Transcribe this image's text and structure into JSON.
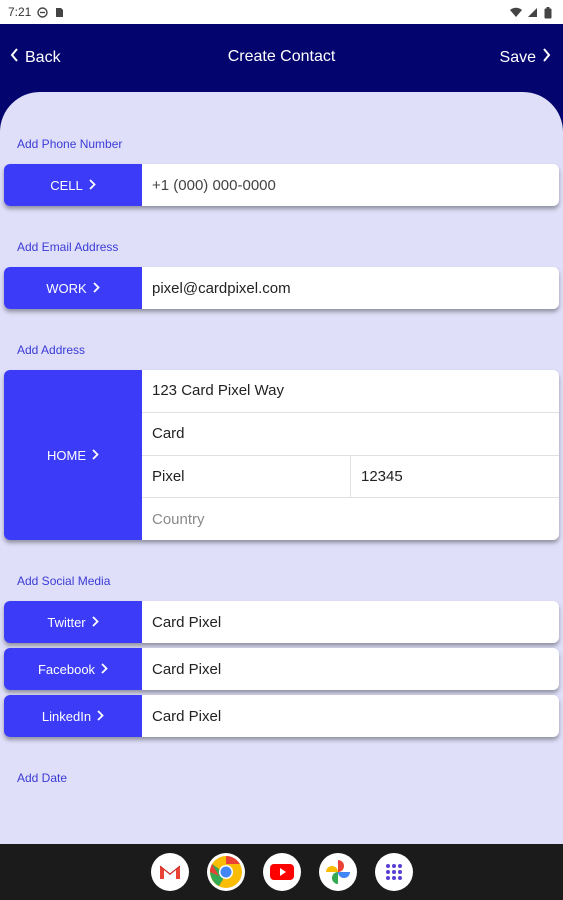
{
  "status_bar": {
    "time": "7:21"
  },
  "nav": {
    "back_label": "Back",
    "title": "Create Contact",
    "save_label": "Save"
  },
  "phone": {
    "section_label": "Add Phone Number",
    "tag": "CELL",
    "value": "+1 (000) 000-0000"
  },
  "email": {
    "section_label": "Add Email Address",
    "tag": "WORK",
    "value": "pixel@cardpixel.com"
  },
  "address": {
    "section_label": "Add Address",
    "tag": "HOME",
    "street": "123 Card Pixel Way",
    "line2": "Card",
    "city": "Pixel",
    "zip": "12345",
    "country_placeholder": "Country"
  },
  "social": {
    "section_label": "Add Social Media",
    "items": [
      {
        "tag": "Twitter",
        "value": "Card Pixel"
      },
      {
        "tag": "Facebook",
        "value": "Card Pixel"
      },
      {
        "tag": "LinkedIn",
        "value": "Card Pixel"
      }
    ]
  },
  "date": {
    "section_label": "Add Date"
  },
  "dock": {
    "apps": [
      "gmail-icon",
      "chrome-icon",
      "youtube-icon",
      "photos-icon",
      "app-drawer-icon"
    ]
  },
  "colors": {
    "nav_bg": "#04046f",
    "content_bg": "#dfdff9",
    "tag_bg": "#3b3bf8",
    "label_color": "#3b3bd6"
  }
}
